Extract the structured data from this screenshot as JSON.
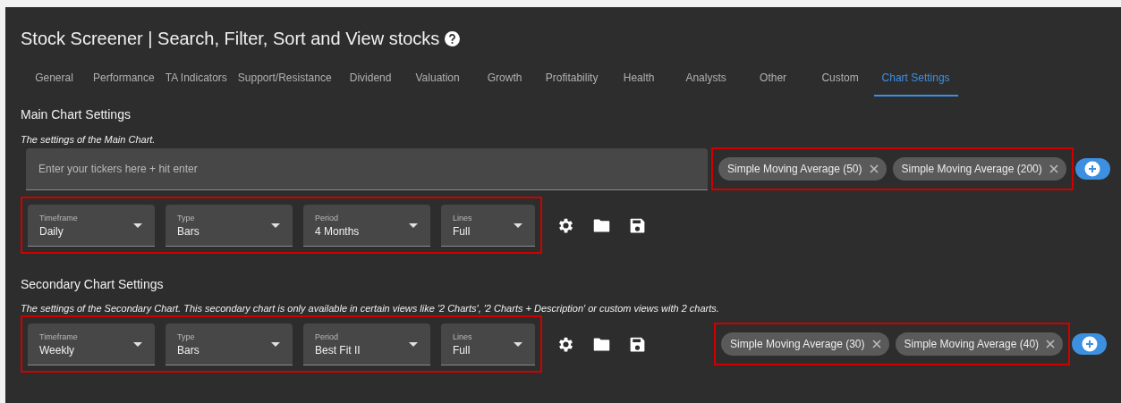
{
  "title": "Stock Screener | Search, Filter, Sort and View stocks",
  "tabs": [
    {
      "label": "General",
      "selected": false
    },
    {
      "label": "Performance",
      "selected": false
    },
    {
      "label": "TA Indicators",
      "selected": false
    },
    {
      "label": "Support/Resistance",
      "selected": false
    },
    {
      "label": "Dividend",
      "selected": false
    },
    {
      "label": "Valuation",
      "selected": false
    },
    {
      "label": "Growth",
      "selected": false
    },
    {
      "label": "Profitability",
      "selected": false
    },
    {
      "label": "Health",
      "selected": false
    },
    {
      "label": "Analysts",
      "selected": false
    },
    {
      "label": "Other",
      "selected": false
    },
    {
      "label": "Custom",
      "selected": false
    },
    {
      "label": "Chart Settings",
      "selected": true
    }
  ],
  "sections": [
    {
      "heading": "Main Chart Settings",
      "description": "The settings of the Main Chart.",
      "ticker_input": {
        "placeholder": "Enter your tickers here + hit enter"
      },
      "selects": {
        "highlighted": true,
        "fields": [
          {
            "label": "Timeframe",
            "value": "Daily"
          },
          {
            "label": "Type",
            "value": "Bars"
          },
          {
            "label": "Period",
            "value": "4 Months"
          },
          {
            "label": "Lines",
            "value": "Full"
          }
        ]
      },
      "indicators": {
        "highlighted": true,
        "chips": [
          {
            "label": "Simple Moving Average (50)"
          },
          {
            "label": "Simple Moving Average (200)"
          }
        ]
      }
    },
    {
      "heading": "Secondary Chart Settings",
      "description": "The settings of the Secondary Chart. This secondary chart is only available in certain views like '2 Charts', '2 Charts + Description' or custom views with 2 charts.",
      "selects": {
        "highlighted": true,
        "fields": [
          {
            "label": "Timeframe",
            "value": "Weekly"
          },
          {
            "label": "Type",
            "value": "Bars"
          },
          {
            "label": "Period",
            "value": "Best Fit II"
          },
          {
            "label": "Lines",
            "value": "Full"
          }
        ]
      },
      "indicators": {
        "highlighted": true,
        "chips": [
          {
            "label": "Simple Moving Average (30)"
          },
          {
            "label": "Simple Moving Average (40)"
          }
        ]
      }
    }
  ]
}
